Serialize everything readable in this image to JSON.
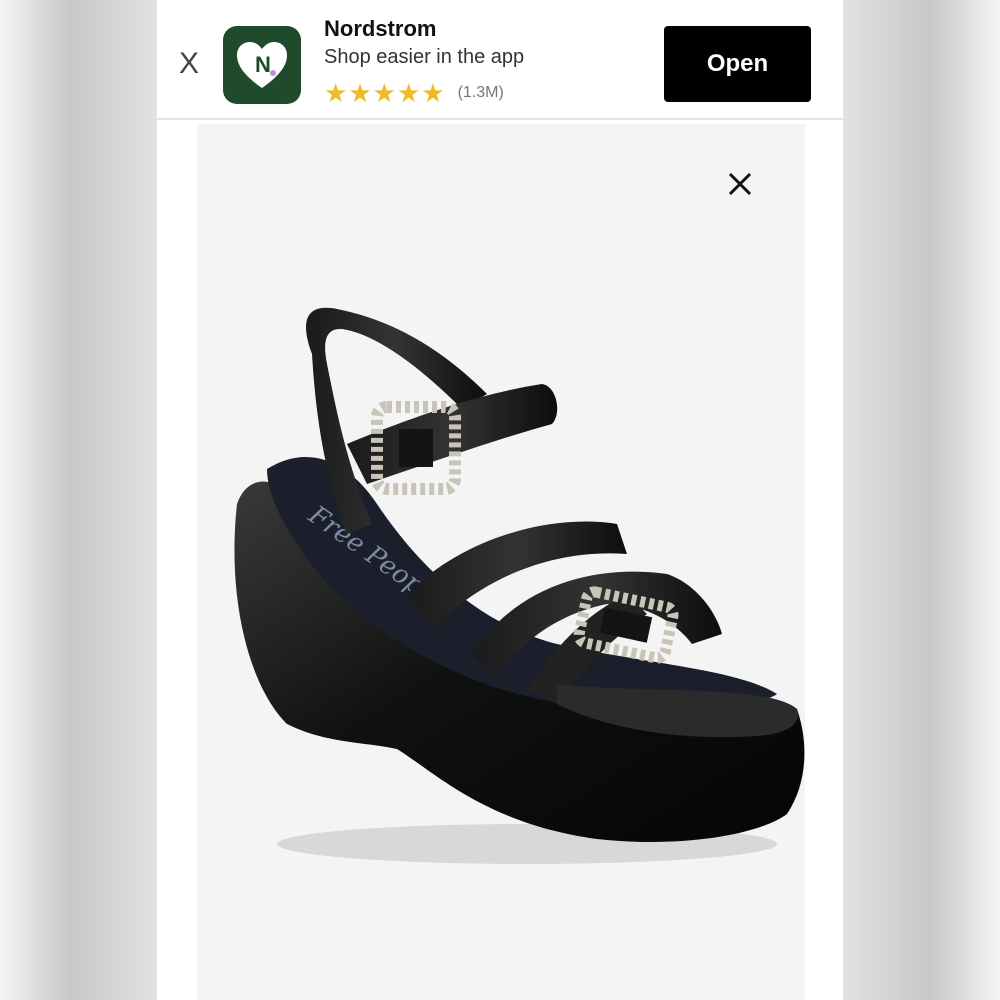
{
  "smart_banner": {
    "close_label": "X",
    "app_name": "Nordstrom",
    "tagline": "Shop easier in the app",
    "rating_stars": 5,
    "rating_count": "(1.3M)",
    "open_label": "Open",
    "icon": "nordstrom-heart-logo",
    "colors": {
      "icon_bg": "#1f4a2c",
      "star": "#f1b928",
      "button_bg": "#000000"
    }
  },
  "product_viewer": {
    "close_icon": "close-icon",
    "image": "black-platform-wedge-sandal",
    "insole_brand_script": "Free People"
  }
}
